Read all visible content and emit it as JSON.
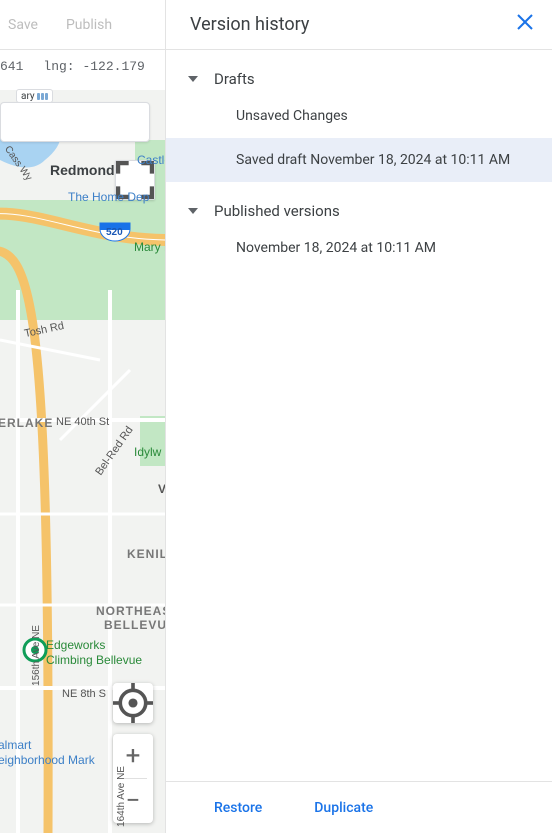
{
  "topbar": {
    "save": "Save",
    "publish": "Publish"
  },
  "coords": {
    "lat_label": "641",
    "lng_label": "lng:",
    "lng_value": "-122.179"
  },
  "map": {
    "lib_chip": "ary",
    "labels": {
      "redmond": "Redmond",
      "homedepot": "The Home Dep",
      "marymoor": "Mary Moor P",
      "castle": "Castle",
      "tosh": "Tosh Rd",
      "erlake": "ERLAKE",
      "ne40": "NE 40th St",
      "belred": "Bel-Red Rd",
      "idylwood": "Idylw",
      "v": "V",
      "kenil": "KENIL",
      "nebellevue1": "NORTHEAST",
      "nebellevue2": "BELLEVUE",
      "edge1": "Edgeworks",
      "edge2": "Climbing Bellevue",
      "ne8": "NE 8th S",
      "walmart1": "almart",
      "walmart2": "eighborhood Mark",
      "street156": "156th Ave NE",
      "street164": "164th Ave NE",
      "hwy520": "520",
      "cass": "Cass Wy"
    },
    "zoom": {
      "plus": "+",
      "minus": "−"
    }
  },
  "panel": {
    "title": "Version history",
    "sections": {
      "drafts": {
        "label": "Drafts",
        "items": [
          "Unsaved Changes",
          "Saved draft November 18, 2024 at 10:11 AM"
        ],
        "selected": 1
      },
      "published": {
        "label": "Published versions",
        "items": [
          "November 18, 2024 at 10:11 AM"
        ]
      }
    },
    "footer": {
      "restore": "Restore",
      "duplicate": "Duplicate"
    }
  }
}
